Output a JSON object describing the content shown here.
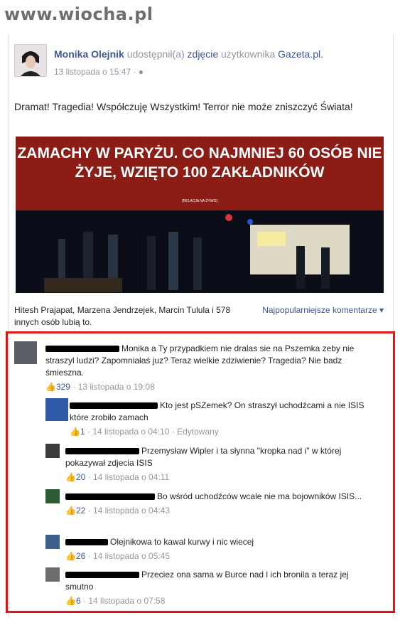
{
  "watermark": "www.wiocha.pl",
  "post": {
    "author": "Monika Olejnik",
    "action": "udostępnił(a)",
    "object": "zdjęcie",
    "object_suffix": "użytkownika",
    "source": "Gazeta.pl.",
    "date": "13 listopada o 15:47 ·",
    "text": "Dramat! Tragedia! Współczuję Wszystkim! Terror nie może zniszczyć Świata!",
    "image_title": "ZAMACHY W PARYŻU. CO NAJMNIEJ 60 OSÓB NIE ŻYJE, WZIĘTO 100 ZAKŁADNIKÓW",
    "image_subtitle": "[RELACJA NA ŻYWO]"
  },
  "likes": {
    "text": "Hitesh Prajapat, Marzena Jendrzejek, Marcin Tulula i 578 innych osób lubią to.",
    "sort_label": "Najpopularniejsze komentarze ▾"
  },
  "comments": [
    {
      "text": "Monika a Ty przypadkiem nie dralas sie na Pszemka zeby nie straszyl ludzi? Zapomniałaś juz? Teraz wielkie zdziwienie? Tragedia? Nie badz śmieszna.",
      "likes": "329",
      "date": "· 13 listopada o 19:08"
    },
    {
      "text": "Kto jest pSZemek? On straszył uchodźcami a nie ISIS które zrobiło zamach",
      "likes": "1",
      "date": "· 14 listopada o 04:10 · Edytowany"
    },
    {
      "text": "Przemysław Wipler i ta słynna \"kropka nad i\" w której pokazywał zdjecia ISIS",
      "likes": "20",
      "date": "· 14 listopada o 04:11"
    },
    {
      "text": "Bo wśród uchodźców wcale nie ma bojowników ISIS...",
      "likes": "22",
      "date": "· 14 listopada o 04:43"
    },
    {
      "text": "Olejnikowa to kawal kurwy i nic wiecej",
      "likes": "26",
      "date": "· 14 listopada o 05:45"
    },
    {
      "text": "Przeciez ona sama w Burce nad l ich bronila a teraz jej smutno",
      "likes": "6",
      "date": "· 14 listopada o 07:58"
    }
  ]
}
